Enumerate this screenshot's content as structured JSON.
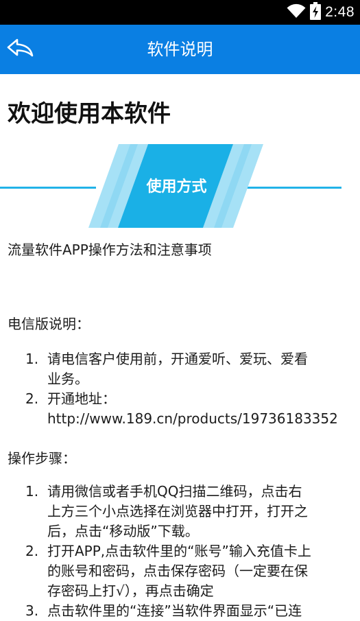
{
  "status_bar": {
    "time": "2:48"
  },
  "app_bar": {
    "title": "软件说明"
  },
  "page": {
    "welcome_title": "欢迎使用本软件",
    "section_banner": "使用方式",
    "intro": "流量软件APP操作方法和注意事项",
    "telecom_heading": "电信版说明：",
    "telecom_items": [
      {
        "number": "1.",
        "lines": [
          "请电信客户使用前，开通爱听、爱玩、爱看",
          "业务。"
        ]
      },
      {
        "number": "2.",
        "lines": [
          "开通地址：",
          "http://www.189.cn/products/19736183352"
        ]
      }
    ],
    "steps_heading": "操作步骤：",
    "steps_items": [
      {
        "number": "1.",
        "lines": [
          "请用微信或者手机QQ扫描二维码，点击右",
          "上方三个小点选择在浏览器中打开，打开之",
          "后，点击“移动版”下载。"
        ]
      },
      {
        "number": "2.",
        "lines": [
          "打开APP,点击软件里的“账号”输入充值卡上",
          "的账号和密码，点击保存密码（一定要在保",
          "存密码上打√），再点击确定"
        ]
      },
      {
        "number": "3.",
        "lines": [
          "点击软件里的“连接”当软件界面显示“已连"
        ]
      }
    ]
  },
  "colors": {
    "app_bar": "#0a7fe3",
    "banner_main": "#1ab0e6",
    "banner_light": "#a6e1f6",
    "banner_line": "#21b3e8"
  }
}
